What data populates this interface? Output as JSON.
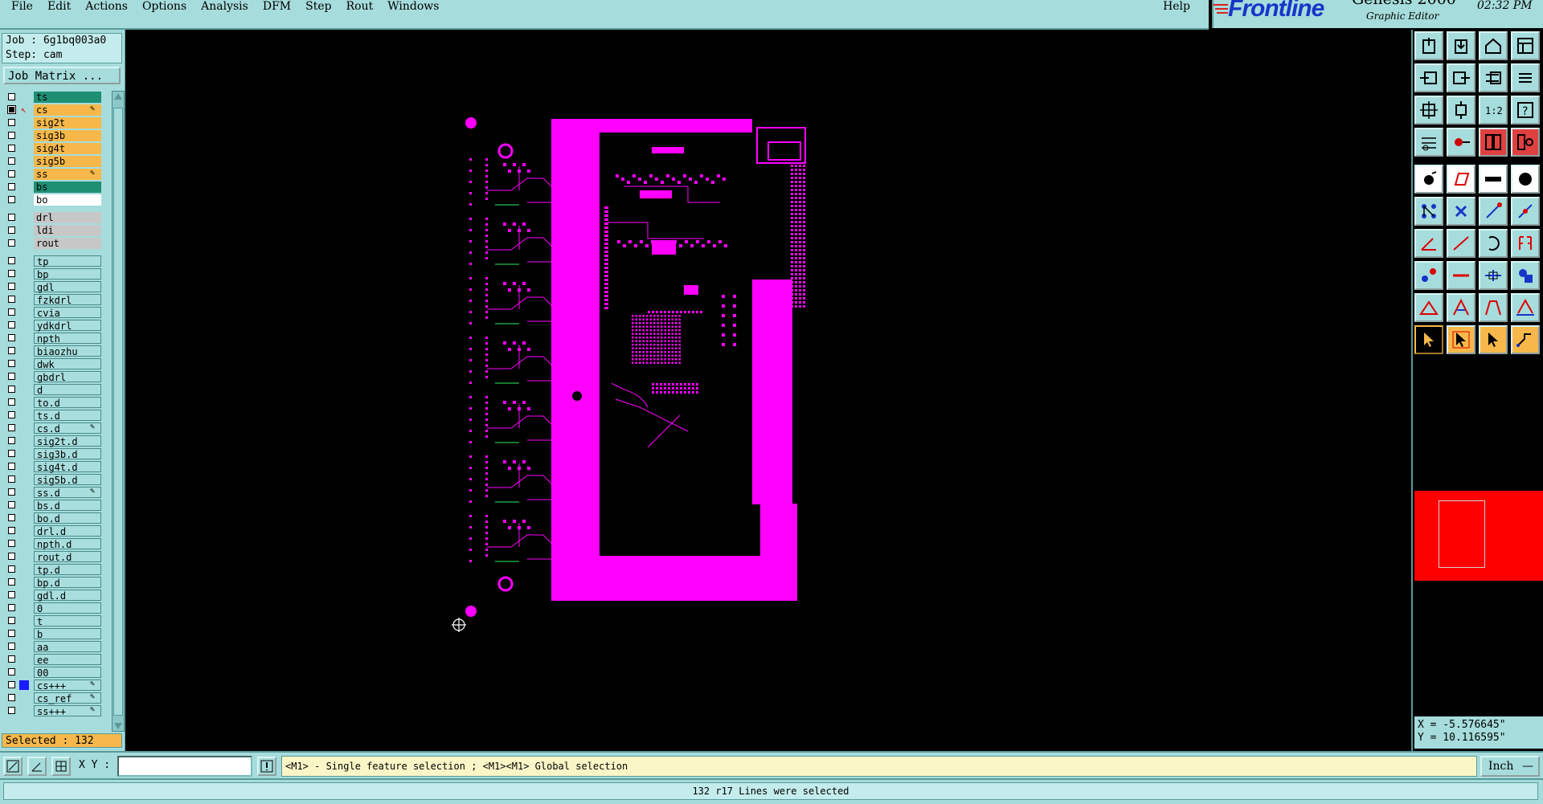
{
  "menu": {
    "items": [
      "File",
      "Edit",
      "Actions",
      "Options",
      "Analysis",
      "DFM",
      "Step",
      "Rout",
      "Windows"
    ],
    "help": "Help"
  },
  "brand": {
    "logo": "Frontline",
    "product": "Genesis 2000",
    "subtitle": "Graphic Editor",
    "time": "02:32 PM"
  },
  "job": {
    "job_label": "Job : 6g1bq003a0",
    "step_label": "Step: cam",
    "matrix_button": "Job Matrix ..."
  },
  "layers": [
    {
      "name": "ts",
      "color": "teal",
      "checked": false
    },
    {
      "name": "cs",
      "color": "orange",
      "checked": true,
      "active": true,
      "edit": true
    },
    {
      "name": "sig2t",
      "color": "orange",
      "checked": false
    },
    {
      "name": "sig3b",
      "color": "orange",
      "checked": false
    },
    {
      "name": "sig4t",
      "color": "orange",
      "checked": false
    },
    {
      "name": "sig5b",
      "color": "orange",
      "checked": false
    },
    {
      "name": "ss",
      "color": "orange",
      "checked": false,
      "edit": true
    },
    {
      "name": "bs",
      "color": "teal",
      "checked": false
    },
    {
      "name": "bo",
      "color": "white",
      "checked": false
    },
    {
      "sep": true
    },
    {
      "name": "drl",
      "color": "grey",
      "checked": false
    },
    {
      "name": "ldi",
      "color": "grey",
      "checked": false
    },
    {
      "name": "rout",
      "color": "grey",
      "checked": false
    },
    {
      "sep": true
    },
    {
      "name": "tp",
      "color": "lt",
      "checked": false
    },
    {
      "name": "bp",
      "color": "lt",
      "checked": false
    },
    {
      "name": "gdl",
      "color": "lt",
      "checked": false
    },
    {
      "name": "fzkdrl",
      "color": "lt",
      "checked": false
    },
    {
      "name": "cvia",
      "color": "lt",
      "checked": false
    },
    {
      "name": "ydkdrl",
      "color": "lt",
      "checked": false
    },
    {
      "name": "npth",
      "color": "lt",
      "checked": false
    },
    {
      "name": "biaozhu",
      "color": "lt",
      "checked": false
    },
    {
      "name": "dwk",
      "color": "lt",
      "checked": false
    },
    {
      "name": "gbdrl",
      "color": "lt",
      "checked": false
    },
    {
      "name": "d",
      "color": "lt",
      "checked": false
    },
    {
      "name": "to.d",
      "color": "lt",
      "checked": false
    },
    {
      "name": "ts.d",
      "color": "lt",
      "checked": false
    },
    {
      "name": "cs.d",
      "color": "lt",
      "checked": false,
      "edit": true
    },
    {
      "name": "sig2t.d",
      "color": "lt",
      "checked": false
    },
    {
      "name": "sig3b.d",
      "color": "lt",
      "checked": false
    },
    {
      "name": "sig4t.d",
      "color": "lt",
      "checked": false
    },
    {
      "name": "sig5b.d",
      "color": "lt",
      "checked": false
    },
    {
      "name": "ss.d",
      "color": "lt",
      "checked": false,
      "edit": true
    },
    {
      "name": "bs.d",
      "color": "lt",
      "checked": false
    },
    {
      "name": "bo.d",
      "color": "lt",
      "checked": false
    },
    {
      "name": "drl.d",
      "color": "lt",
      "checked": false
    },
    {
      "name": "npth.d",
      "color": "lt",
      "checked": false
    },
    {
      "name": "rout.d",
      "color": "lt",
      "checked": false
    },
    {
      "name": "tp.d",
      "color": "lt",
      "checked": false
    },
    {
      "name": "bp.d",
      "color": "lt",
      "checked": false
    },
    {
      "name": "gdl.d",
      "color": "lt",
      "checked": false
    },
    {
      "name": "0",
      "color": "lt",
      "checked": false
    },
    {
      "name": "t",
      "color": "lt",
      "checked": false
    },
    {
      "name": "b",
      "color": "lt",
      "checked": false
    },
    {
      "name": "aa",
      "color": "lt",
      "checked": false
    },
    {
      "name": "ee",
      "color": "lt",
      "checked": false
    },
    {
      "name": "00",
      "color": "lt",
      "checked": false
    },
    {
      "name": "cs+++",
      "color": "lt",
      "checked": false,
      "blue": true,
      "edit": true
    },
    {
      "name": "cs_ref",
      "color": "lt",
      "checked": false,
      "edit": true
    },
    {
      "name": "ss+++",
      "color": "lt",
      "checked": false,
      "edit": true
    }
  ],
  "selected_label": "Selected : 132",
  "coords": {
    "x": "X = -5.576645\"",
    "y": "Y = 10.116595\""
  },
  "bottom": {
    "xy_label": "X Y :",
    "xy_value": "",
    "prompt": "<M1> - Single feature selection ; <M1><M1> Global selection",
    "unit": "Inch"
  },
  "status": "132 r17 Lines were selected",
  "colors": {
    "panel": "#a6dcdc",
    "feature": "#ff00ff",
    "canvas": "#000000",
    "highlight": "#f6b84a"
  }
}
